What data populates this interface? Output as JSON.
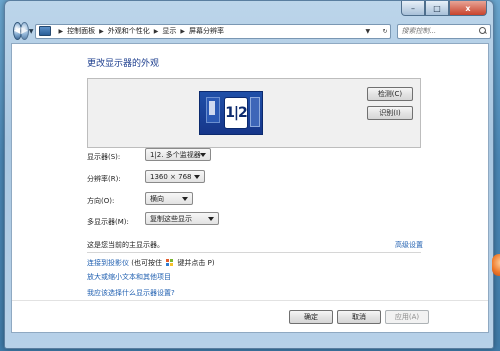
{
  "window": {
    "controls": {
      "minimize": "–",
      "maximize": "□",
      "close": "x"
    }
  },
  "nav": {
    "back_glyph": "◀",
    "forward_glyph": "▶",
    "breadcrumbs": [
      "控制面板",
      "外观和个性化",
      "显示",
      "屏幕分辨率"
    ],
    "search_placeholder": "搜索控制..."
  },
  "page": {
    "title": "更改显示器的外观",
    "monitor_badge": "1|2",
    "detect_button": "检测(C)",
    "identify_button": "识别(I)"
  },
  "settings": {
    "display": {
      "label": "显示器(S):",
      "value": "1|2. 多个监视器"
    },
    "resolution": {
      "label": "分辨率(R):",
      "value": "1360 × 768"
    },
    "orientation": {
      "label": "方向(O):",
      "value": "横向"
    },
    "multiple_displays": {
      "label": "多显示器(M):",
      "value": "复制这些显示"
    }
  },
  "info": {
    "main_display_text": "这是您当前的主显示器。",
    "advanced_link": "高级设置"
  },
  "links": {
    "projector_text": "连接到投影仪",
    "projector_hint_prefix": "(也可按住",
    "projector_hint_suffix": "键并点击 P)",
    "enlarge_text": "放大或缩小文本和其他项目",
    "which_settings": "我应该选择什么显示器设置?"
  },
  "footer": {
    "ok_button": "确定",
    "cancel_button": "取消",
    "apply_button": "应用(A)"
  }
}
